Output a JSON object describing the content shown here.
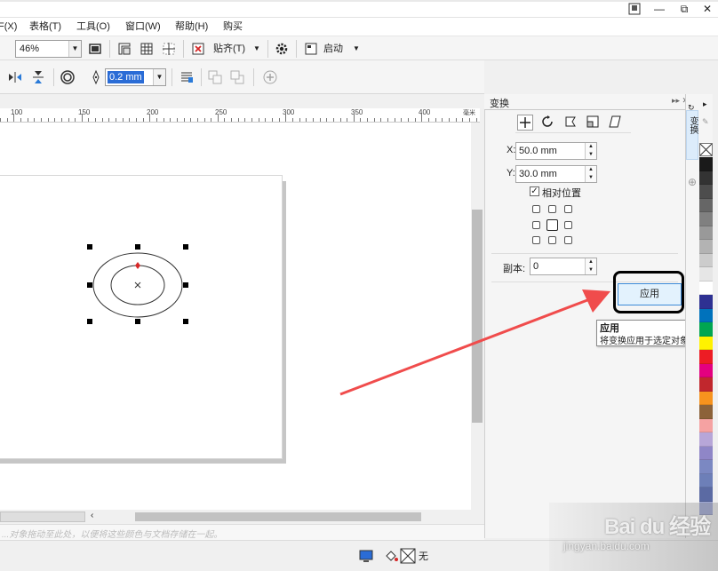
{
  "window": {
    "restore_glyph": "⧉",
    "minimize_glyph": "—",
    "close_glyph": "✕"
  },
  "menubar": {
    "items": [
      "F(X)",
      "表格(T)",
      "工具(O)",
      "窗口(W)",
      "帮助(H)",
      "购买"
    ]
  },
  "toolbar1": {
    "zoom_value": "46%",
    "snap_label": "贴齐(T)",
    "launch_label": "启动"
  },
  "toolbar2": {
    "outline_width": "0.2 mm"
  },
  "ruler": {
    "labels": [
      "100",
      "150",
      "200",
      "250",
      "300",
      "350",
      "400"
    ],
    "unit": "毫米"
  },
  "panel": {
    "title": "变换",
    "x_label": "X:",
    "x_value": "50.0 mm",
    "y_label": "Y:",
    "y_value": "30.0 mm",
    "relative_label": "相对位置",
    "relative_checked": true,
    "copies_label": "副本:",
    "copies_value": "0",
    "apply_label": "应用",
    "side_tab_label": "变换"
  },
  "tooltip": {
    "title": "应用",
    "description": "将变换应用于选定对象。"
  },
  "status": {
    "hint": "...对象拖动至此处，以便将这些颜色与文档存储在一起。"
  },
  "bottombar": {
    "fill_label": "无"
  },
  "watermark": {
    "brand": "Bai du 经验",
    "url": "jingyan.baidu.com"
  },
  "palette": {
    "colors": [
      "#1a1a1a",
      "#333333",
      "#4d4d4d",
      "#666666",
      "#808080",
      "#999999",
      "#b3b3b3",
      "#cccccc",
      "#e6e6e6",
      "#ffffff",
      "#2e3192",
      "#0072bc",
      "#00a651",
      "#fff200",
      "#ed1c24",
      "#e4007f",
      "#c1272d",
      "#f7931e",
      "#8c6239",
      "#f5a2a2",
      "#b7a6d8",
      "#8f86c7",
      "#7b88c2",
      "#6d7fb8",
      "#5b6aa3",
      "#9fa7d4"
    ]
  },
  "colors": {
    "selection_red": "#d62828",
    "arrow_red": "#f04c4c",
    "apply_blue": "#3c8ad8"
  }
}
